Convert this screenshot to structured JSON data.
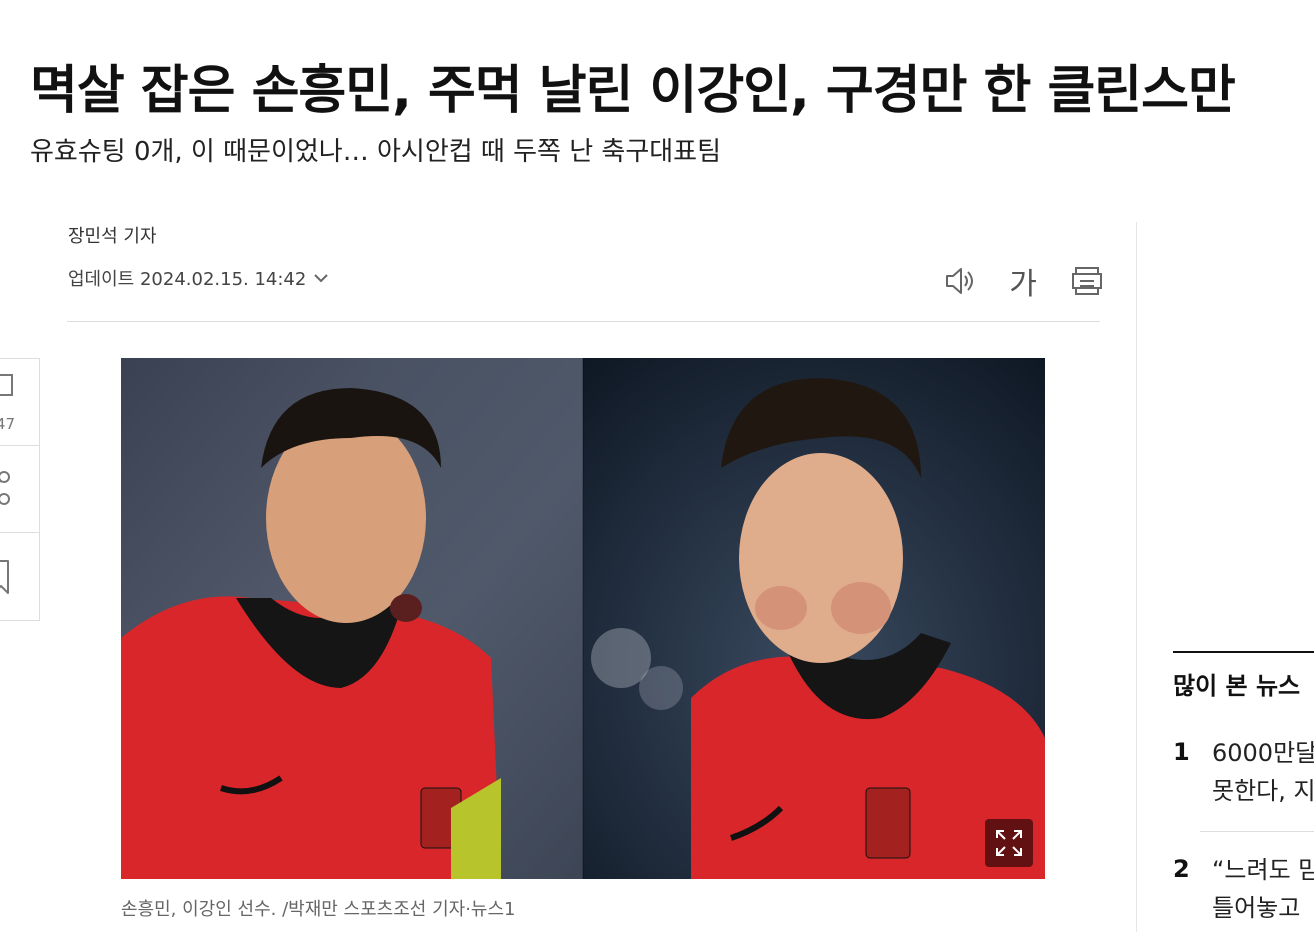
{
  "article": {
    "headline": "멱살 잡은 손흥민, 주먹 날린 이강인, 구경만 한 클린스만",
    "subhead": "유효슈팅 0개, 이 때문이었나… 아시안컵 때 두쪽 난 축구대표팀",
    "author": "장민석 기자",
    "updated": "업데이트 2024.02.15. 14:42",
    "caption": "손흥민, 이강인 선수. /박재만 스포츠조선 기자·뉴스1"
  },
  "tools": {
    "font_label": "가",
    "icons": [
      "speaker-icon",
      "font-size-icon",
      "print-icon"
    ]
  },
  "side_rail": {
    "comment_count": "47",
    "icons": [
      "comment-icon",
      "share-icon",
      "bookmark-icon"
    ]
  },
  "popular": {
    "title": "많이 본 뉴스",
    "items": [
      {
        "rank": "1",
        "title": "6000만달\n못한다, 지"
      },
      {
        "rank": "2",
        "title": "“느려도 맘\n틀어놓고"
      }
    ]
  },
  "colors": {
    "jersey_red": "#e0282c",
    "text": "#111111",
    "caption": "#666666",
    "divider": "#dddddd"
  }
}
